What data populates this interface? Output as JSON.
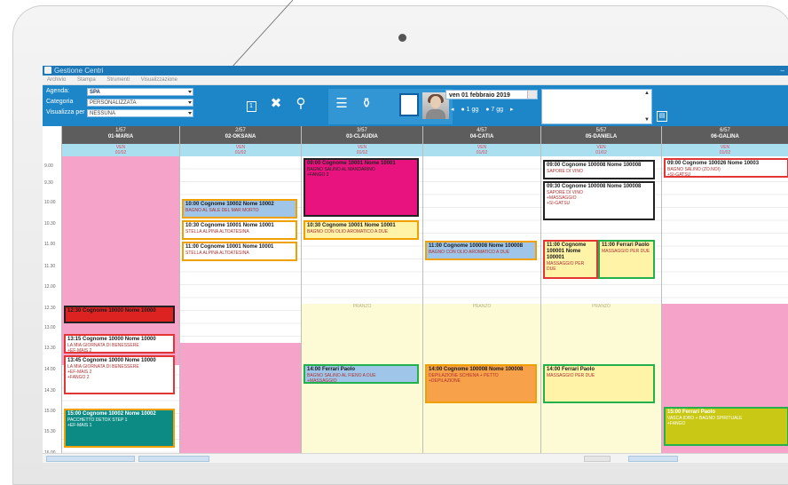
{
  "app": {
    "title": "Gestione Centri",
    "menu": [
      "Archivio",
      "Stampa",
      "Strumenti",
      "Visualizzazione"
    ]
  },
  "filters": {
    "agenda_label": "Agenda:",
    "agenda_value": "SPA",
    "categoria_label": "Categoria",
    "categoria_value": "PERSONALIZZATA",
    "visualizza_label": "Visualizza per",
    "visualizza_value": "NESSUNA"
  },
  "toolbar": {
    "calendar_day": "1",
    "date_value": "ven 01 febbraio 2019",
    "nav_prev": "◂",
    "view_option_1": "● 1 gg",
    "view_option_2": "● 7 gg",
    "nav_next": "▸"
  },
  "icons": {
    "calendar": "calendar-icon",
    "tools": "tools-icon",
    "brush": "brush-icon",
    "list": "list-icon",
    "money": "money-bag-icon",
    "save": "save-icon"
  },
  "hours": [
    "9.00",
    "9.30",
    "10.00",
    "10.30",
    "11.00",
    "11.30",
    "12.00",
    "12.30",
    "13.00",
    "13.30",
    "14.00",
    "14.30",
    "15.00",
    "15.30",
    "16.00"
  ],
  "columns": [
    {
      "num": "1/57",
      "name": "01-MARIA",
      "sub1": "VEN",
      "sub2": "01/02"
    },
    {
      "num": "2/57",
      "name": "02-OKSANA",
      "sub1": "VEN",
      "sub2": "01/02"
    },
    {
      "num": "3/57",
      "name": "03-CLAUDIA",
      "sub1": "VEN",
      "sub2": "01/02"
    },
    {
      "num": "4/57",
      "name": "04-CATIA",
      "sub1": "VEN",
      "sub2": "01/02"
    },
    {
      "num": "5/57",
      "name": "05-DANIELA",
      "sub1": "VEN",
      "sub2": "01/02"
    },
    {
      "num": "6/57",
      "name": "06-GALINA",
      "sub1": "VEN",
      "sub2": "01/02"
    }
  ],
  "bands": {
    "pranzo": "PRANZO"
  },
  "events": {
    "c1_a": {
      "title": "12:30 Cognome 10000 Nome 10000"
    },
    "c1_b": {
      "title": "13:15 Cognome 10000 Nome 10000",
      "l1": "LA MIA GIORNATA DI BENESSERE",
      "l2": "+EF-MAIS 2"
    },
    "c1_c": {
      "title": "13:45 Cognome 10000 Nome 10000",
      "l1": "LA MIA GIORNATA DI BENESSERE",
      "l2": "+EF-MAIS 2",
      "l3": "+FANGO 2"
    },
    "c1_d": {
      "title": "15:00 Cognome 10002 Nome 10002",
      "l1": "PACCHETTO DETOX STEP 1",
      "l2": "+EF-MAIS 1"
    },
    "c2_a": {
      "title": "10:00 Cognome 10002 Nome 10002",
      "l1": "BAGNO AL SALE DEL MAR MORTO"
    },
    "c2_b": {
      "title": "10:30 Cognome 10001 Nome 10001",
      "l1": "STELLA ALPINA ALTOATESINA"
    },
    "c2_c": {
      "title": "11:00 Cognome 10001 Nome 10001",
      "l1": "STELLA ALPINA ALTOATESINA"
    },
    "c3_a": {
      "title": "09:00 Cognome 10001 Nome 10001",
      "l1": "BAGNO SALINO AL MANDARINO",
      "l2": "+FANGO 2"
    },
    "c3_b": {
      "title": "10:30 Cognome 10001 Nome 10001",
      "l1": "BAGNO CON OLIO AROMATICO A DUE"
    },
    "c3_c": {
      "title": "14:00 Ferrari Paolo",
      "l1": "BAGNO SALINO AL FIENO A DUE",
      "l2": "+MASSAGGIO"
    },
    "c4_a": {
      "title": "11:00 Cognome 100008 Nome 100008",
      "l1": "BAGNO CON OLIO AROMATICO A DUE"
    },
    "c4_b": {
      "title": "14:00 Cognome 100008 Nome 100008",
      "l1": "DEPILAZIONE SCHIENA + PETTO",
      "l2": "+DEPILAZIONE"
    },
    "c5_a": {
      "title": "09:00 Cognome 100008 Nome 100008",
      "l1": "SAPORE DI VINO"
    },
    "c5_b": {
      "title": "09:30 Cognome 100008 Nome 100008",
      "l1": "SAPORE DI VINO",
      "l2": "+MASSAGGIO",
      "l3": "+SI-GATSU"
    },
    "c5_c": {
      "title": "11:00 Cognome 100001 Nome 100001",
      "l1": "MASSAGGIO PER DUE"
    },
    "c5_d": {
      "title": "11:00 Ferrari Paolo",
      "l1": "MASSAGGIO PER DUE"
    },
    "c5_e": {
      "title": "14:00 Ferrari Paolo",
      "l1": "MASSAGGIO PER DUE"
    },
    "c6_a": {
      "title": "09:00 Cognome 100026 Nome 10003",
      "l1": "BAGNO SALINO (ZO.NOI)",
      "l2": "+SI-GATSU"
    },
    "c6_b": {
      "title": "15:00 Ferrari Paolo",
      "l1": "VASCA IDRO + BAGNO SPIRITUALE",
      "l2": "+FANGO"
    }
  },
  "status": {
    "btn1": "",
    "btn2": ""
  }
}
